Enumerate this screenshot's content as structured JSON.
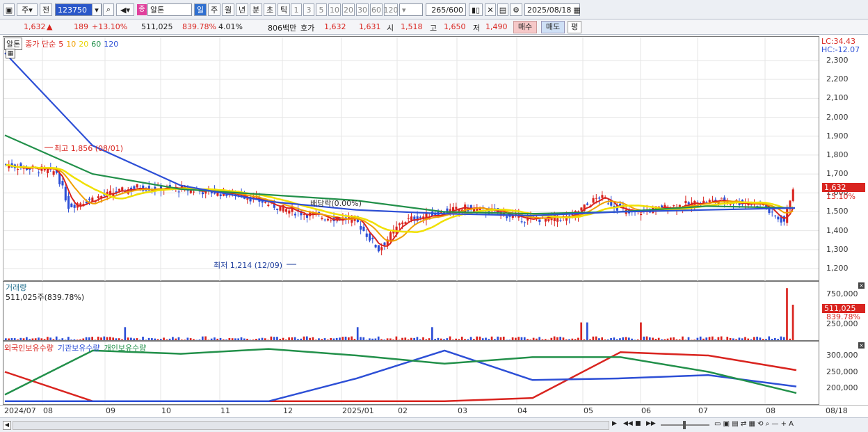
{
  "toolbar": {
    "type_label": "주",
    "prev_label": "전",
    "code": "123750",
    "stock_badge": "종",
    "stock_name": "알톤",
    "periods": [
      "일",
      "주",
      "월",
      "년",
      "분",
      "초",
      "틱"
    ],
    "intervals": [
      "1",
      "3",
      "5",
      "10",
      "20",
      "30",
      "60",
      "120"
    ],
    "count": "265",
    "count_total": "/600",
    "date": "2025/08/18"
  },
  "quote": {
    "price": "1,632",
    "arrow": "▲",
    "change": "189",
    "rate": "+13.10%",
    "volume": "511,025",
    "vol_rate": "839.78%",
    "turnover": "4.01%",
    "amount": "806백만",
    "ask_label": "호가",
    "ask": "1,632",
    "bid": "1,631",
    "open_label": "시",
    "open": "1,518",
    "high_label": "고",
    "high": "1,650",
    "low_label": "저",
    "low": "1,490",
    "buy": "매수",
    "sell": "매도",
    "avg": "평"
  },
  "price_pane": {
    "legend_name": "알톤",
    "legend_type": "종가 단순",
    "ma": [
      "5",
      "10",
      "20",
      "60",
      "120"
    ],
    "ma_colors": [
      "#d9241f",
      "#f0a000",
      "#f0e000",
      "#22904a",
      "#2d4fd6"
    ],
    "lc": "LC:34.43",
    "hc": "HC:-12.07",
    "yticks": [
      "2,300",
      "2,200",
      "2,100",
      "2,000",
      "1,900",
      "1,800",
      "1,700",
      "1,600",
      "1,500",
      "1,400",
      "1,300",
      "1,200"
    ],
    "high_note": "최고 1,856 (08/01)",
    "low_note": "최저 1,214 (12/09)",
    "div_note": "배당락(0.00%)",
    "price_tag": "1,632",
    "rate_tag": "13.10%"
  },
  "volume_pane": {
    "title": "거래량",
    "value": "511,025주(839.78%)",
    "yticks": [
      "750,000",
      "500,000",
      "250,000"
    ],
    "tag1": "511,025",
    "tag2": "839.78%"
  },
  "holding_pane": {
    "legend": [
      "외국인보유수량",
      "기관보유수량",
      "개인보유수량"
    ],
    "yticks": [
      "300,000",
      "250,000",
      "200,000"
    ]
  },
  "xaxis": [
    "2024/07",
    "08",
    "09",
    "10",
    "11",
    "12",
    "2025/01",
    "02",
    "03",
    "04",
    "05",
    "06",
    "07",
    "08",
    "08/18"
  ],
  "chart_data": [
    {
      "type": "line",
      "title": "",
      "series": [
        {
          "name": "120",
          "values": [
            2340,
            1850,
            1640,
            1555,
            1510,
            1490,
            1480,
            1500,
            1510,
            1520
          ]
        },
        {
          "name": "60",
          "values": [
            1905,
            1700,
            1620,
            1590,
            1560,
            1500,
            1490,
            1500,
            1530,
            1520
          ]
        }
      ],
      "ylim": [
        1150,
        2350
      ]
    },
    {
      "type": "bar",
      "title": "거래량",
      "ylim": [
        0,
        850000
      ]
    },
    {
      "type": "line",
      "series": [
        {
          "name": "외국인보유수량",
          "values": [
            250000,
            160000,
            160000,
            160000,
            160000,
            160000,
            170000,
            310000,
            300000,
            255000
          ]
        },
        {
          "name": "기관보유수량",
          "values": [
            160000,
            160000,
            160000,
            160000,
            230000,
            315000,
            225000,
            230000,
            240000,
            205000
          ]
        },
        {
          "name": "개인보유수량",
          "values": [
            180000,
            315000,
            305000,
            320000,
            300000,
            275000,
            295000,
            295000,
            250000,
            185000
          ]
        }
      ]
    }
  ]
}
